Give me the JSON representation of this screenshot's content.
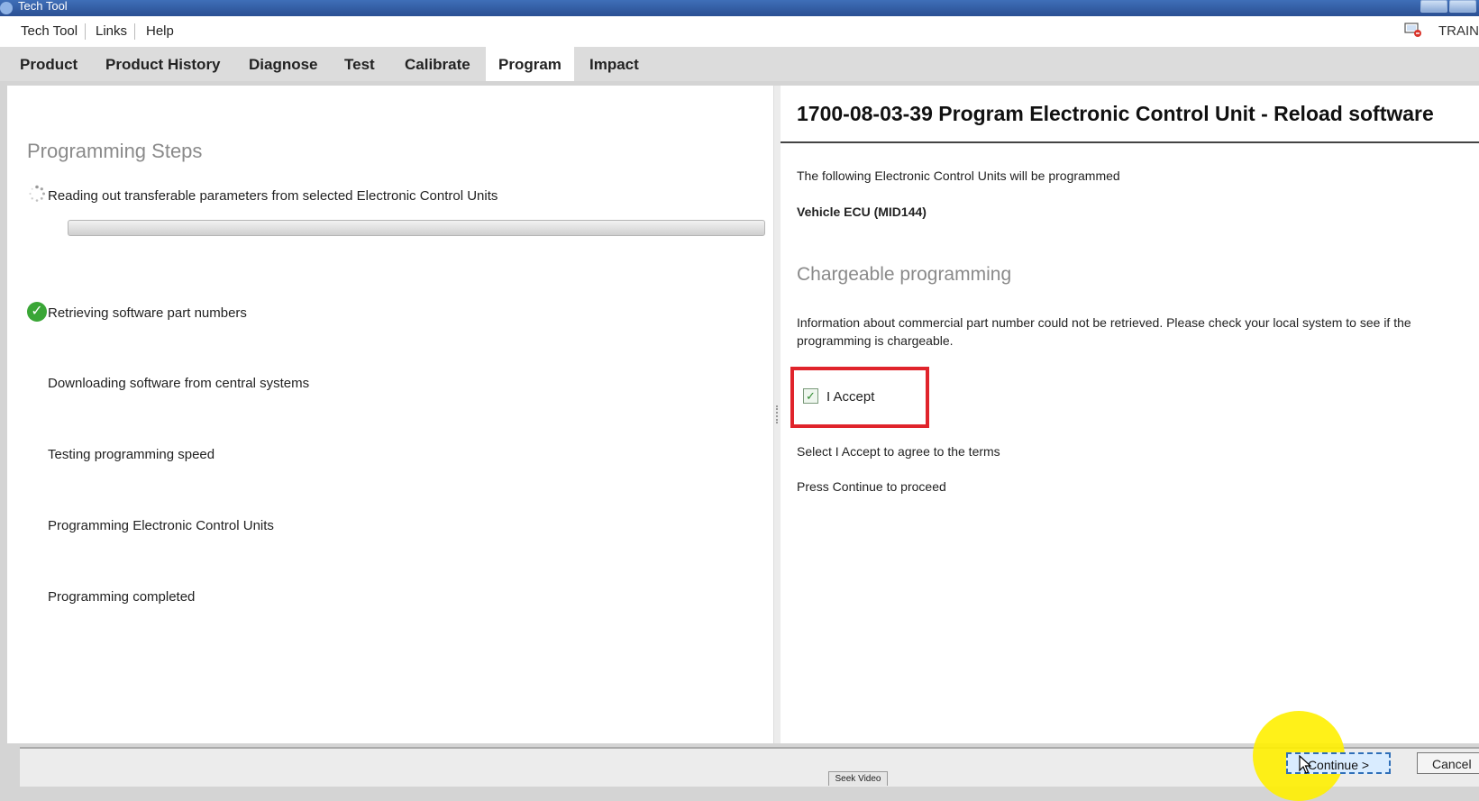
{
  "window": {
    "title": "Tech Tool"
  },
  "menu": {
    "items": [
      "Tech Tool",
      "Links",
      "Help"
    ],
    "train_label": "TRAIN"
  },
  "nav": {
    "tabs": [
      "Product",
      "Product History",
      "Diagnose",
      "Test",
      "Calibrate",
      "Program",
      "Impact"
    ],
    "active": "Program"
  },
  "left": {
    "heading": "Programming Steps",
    "steps": [
      {
        "label": "Reading out transferable parameters from selected Electronic Control Units",
        "status": "in-progress"
      },
      {
        "label": "Retrieving software part numbers",
        "status": "done"
      },
      {
        "label": "Downloading software from central systems",
        "status": "pending"
      },
      {
        "label": "Testing programming speed",
        "status": "pending"
      },
      {
        "label": "Programming Electronic Control Units",
        "status": "pending"
      },
      {
        "label": "Programming completed",
        "status": "pending"
      }
    ],
    "progress_fraction": 0.0
  },
  "right": {
    "title": "1700-08-03-39 Program Electronic Control Unit - Reload software",
    "intro": "The following Electronic Control Units will be programmed",
    "ecu": "Vehicle ECU (MID144)",
    "subtitle": "Chargeable programming",
    "info_line1": "Information about commercial part number could not be retrieved. Please check your local system to see if the",
    "info_line2": "programming is chargeable.",
    "accept_label": "I Accept",
    "accept_checked": true,
    "instruction1": "Select I Accept to agree to the terms",
    "instruction2": "Press Continue to proceed"
  },
  "footer": {
    "continue_label": "Continue >",
    "cancel_label": "Cancel"
  },
  "overlay": {
    "seek_label": "Seek Video"
  },
  "colors": {
    "titlebar": "#2a4f93",
    "highlight_box": "#e0242b",
    "cursor_highlight": "#ffef00",
    "check": "#3aa636"
  }
}
